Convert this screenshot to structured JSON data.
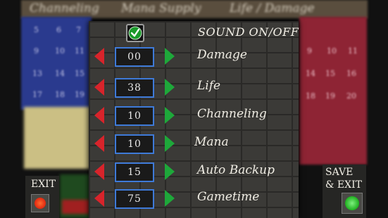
{
  "background": {
    "tabs": [
      "Channeling",
      "Mana Supply",
      "Life / Damage"
    ],
    "blue_grid": [
      "5",
      "6",
      "7",
      "9",
      "10",
      "11",
      "13",
      "14",
      "15",
      "17",
      "18",
      "19"
    ],
    "red_grid": [
      "9",
      "10",
      "11",
      "14",
      "15",
      "16",
      "18",
      "19",
      "20"
    ]
  },
  "sound": {
    "label": "SOUND ON/OFF",
    "checked": true
  },
  "settings": [
    {
      "key": "damage",
      "label": "Damage",
      "value": "00"
    },
    {
      "key": "life",
      "label": "Life",
      "value": "38"
    },
    {
      "key": "channeling",
      "label": "Channeling",
      "value": "10"
    },
    {
      "key": "mana",
      "label": "Mana",
      "value": "10"
    },
    {
      "key": "auto_backup",
      "label": "Auto Backup",
      "value": "15"
    },
    {
      "key": "gametime",
      "label": "Gametime",
      "value": "75"
    }
  ],
  "exit": {
    "label": "EXIT"
  },
  "save_exit": {
    "label_line1": "SAVE",
    "label_line2": "& EXIT"
  },
  "colors": {
    "decrement": "#d8242b",
    "increment": "#1ea83a",
    "value_border": "#3e7ad8",
    "exit_button": "#e02810",
    "save_button": "#1fb01f"
  }
}
